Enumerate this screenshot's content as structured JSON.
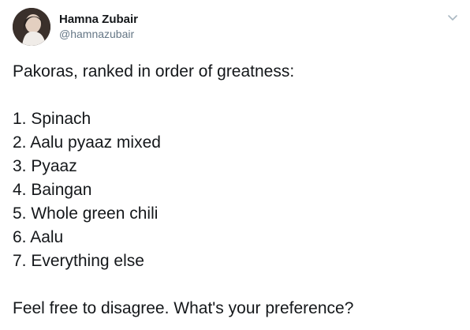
{
  "author": {
    "name": "Hamna Zubair",
    "handle": "@hamnazubair",
    "avatar_icon": "profile-photo"
  },
  "menu_icon": "chevron-down-icon",
  "tweet": {
    "intro": "Pakoras, ranked in order of greatness:",
    "items": [
      "1. Spinach",
      "2. Aalu pyaaz mixed",
      "3. Pyaaz",
      "4. Baingan",
      "5. Whole green chili",
      "6. Aalu",
      "7. Everything else"
    ],
    "outro": "Feel free to disagree. What's your preference?"
  },
  "colors": {
    "text": "#14171a",
    "secondary": "#657786",
    "chevron": "#aab8c2"
  }
}
